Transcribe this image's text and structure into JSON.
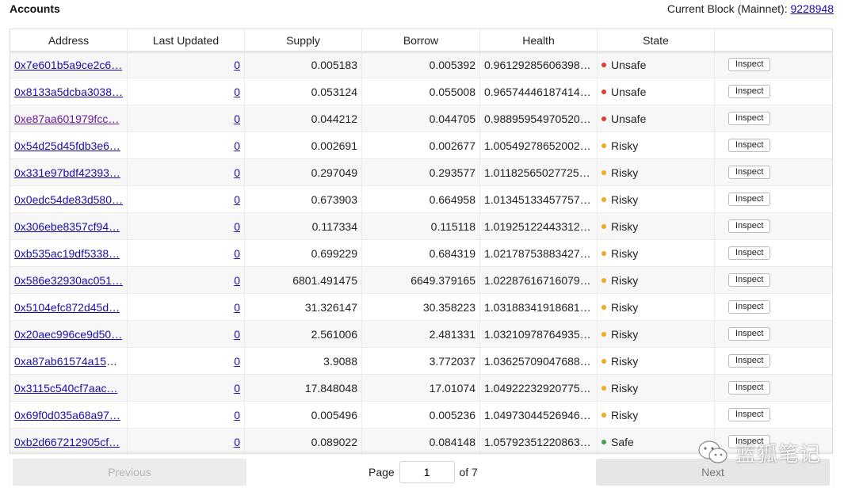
{
  "page_title": "Accounts",
  "block": {
    "label": "Current Block (Mainnet): ",
    "number": "9228948"
  },
  "columns": [
    "Address",
    "Last Updated",
    "Supply",
    "Borrow",
    "Health",
    "State",
    ""
  ],
  "rows": [
    {
      "address": "0x7e601b5a9ce2c6…",
      "updated": "0",
      "supply": "0.005183",
      "borrow": "0.005392",
      "health": "0.96129285606398…",
      "state": "Unsafe",
      "state_color": "#e53935",
      "inspect": "Inspect",
      "visited": false
    },
    {
      "address": "0x8133a5dcba3038…",
      "updated": "0",
      "supply": "0.053124",
      "borrow": "0.055008",
      "health": "0.96574446187414…",
      "state": "Unsafe",
      "state_color": "#e53935",
      "inspect": "Inspect",
      "visited": false
    },
    {
      "address": "0xe87aa601979fcc…",
      "updated": "0",
      "supply": "0.044212",
      "borrow": "0.044705",
      "health": "0.98895954970520…",
      "state": "Unsafe",
      "state_color": "#e53935",
      "inspect": "Inspect",
      "visited": true
    },
    {
      "address": "0x54d25d45fdb3e6…",
      "updated": "0",
      "supply": "0.002691",
      "borrow": "0.002677",
      "health": "1.00549278652002…",
      "state": "Risky",
      "state_color": "#f5a623",
      "inspect": "Inspect",
      "visited": false
    },
    {
      "address": "0x331e97bdf42393…",
      "updated": "0",
      "supply": "0.297049",
      "borrow": "0.293577",
      "health": "1.01182565027725…",
      "state": "Risky",
      "state_color": "#f5a623",
      "inspect": "Inspect",
      "visited": false
    },
    {
      "address": "0x0edc54de83d580…",
      "updated": "0",
      "supply": "0.673903",
      "borrow": "0.664958",
      "health": "1.01345133457757…",
      "state": "Risky",
      "state_color": "#f5a623",
      "inspect": "Inspect",
      "visited": false
    },
    {
      "address": "0x306ebe8357cf94…",
      "updated": "0",
      "supply": "0.117334",
      "borrow": "0.115118",
      "health": "1.01925122443312…",
      "state": "Risky",
      "state_color": "#f5a623",
      "inspect": "Inspect",
      "visited": false
    },
    {
      "address": "0xb535ac19df5338…",
      "updated": "0",
      "supply": "0.699229",
      "borrow": "0.684319",
      "health": "1.02178753883427…",
      "state": "Risky",
      "state_color": "#f5a623",
      "inspect": "Inspect",
      "visited": false
    },
    {
      "address": "0x586e32930ac051…",
      "updated": "0",
      "supply": "6801.491475",
      "borrow": "6649.379165",
      "health": "1.02287616716079…",
      "state": "Risky",
      "state_color": "#f5a623",
      "inspect": "Inspect",
      "visited": false
    },
    {
      "address": "0x5104efc872d45d…",
      "updated": "0",
      "supply": "31.326147",
      "borrow": "30.358223",
      "health": "1.03188341918681…",
      "state": "Risky",
      "state_color": "#f5a623",
      "inspect": "Inspect",
      "visited": false
    },
    {
      "address": "0x20aec996ce9d50…",
      "updated": "0",
      "supply": "2.561006",
      "borrow": "2.481331",
      "health": "1.03210978764935…",
      "state": "Risky",
      "state_color": "#f5a623",
      "inspect": "Inspect",
      "visited": false
    },
    {
      "address": "0xa87ab61574a159…",
      "updated": "0",
      "supply": "3.9088",
      "borrow": "3.772037",
      "health": "1.03625709047688…",
      "state": "Risky",
      "state_color": "#f5a623",
      "inspect": "Inspect",
      "visited": false
    },
    {
      "address": "0x3115c540cf7aac…",
      "updated": "0",
      "supply": "17.848048",
      "borrow": "17.01074",
      "health": "1.04922232920775…",
      "state": "Risky",
      "state_color": "#f5a623",
      "inspect": "Inspect",
      "visited": false
    },
    {
      "address": "0x69f0d035a68a97…",
      "updated": "0",
      "supply": "0.005496",
      "borrow": "0.005236",
      "health": "1.04973044526946…",
      "state": "Risky",
      "state_color": "#f5a623",
      "inspect": "Inspect",
      "visited": false
    },
    {
      "address": "0xb2d667212905cf…",
      "updated": "0",
      "supply": "0.089022",
      "borrow": "0.084148",
      "health": "1.05792351220863…",
      "state": "Safe",
      "state_color": "#43a047",
      "inspect": "Inspect",
      "visited": false
    }
  ],
  "pagination": {
    "previous_label": "Previous",
    "next_label": "Next",
    "page_label": "Page",
    "current_page": "1",
    "of_label": "of 7"
  },
  "watermark": {
    "text": "蓝狐笔记",
    "icon": "wechat-icon"
  }
}
